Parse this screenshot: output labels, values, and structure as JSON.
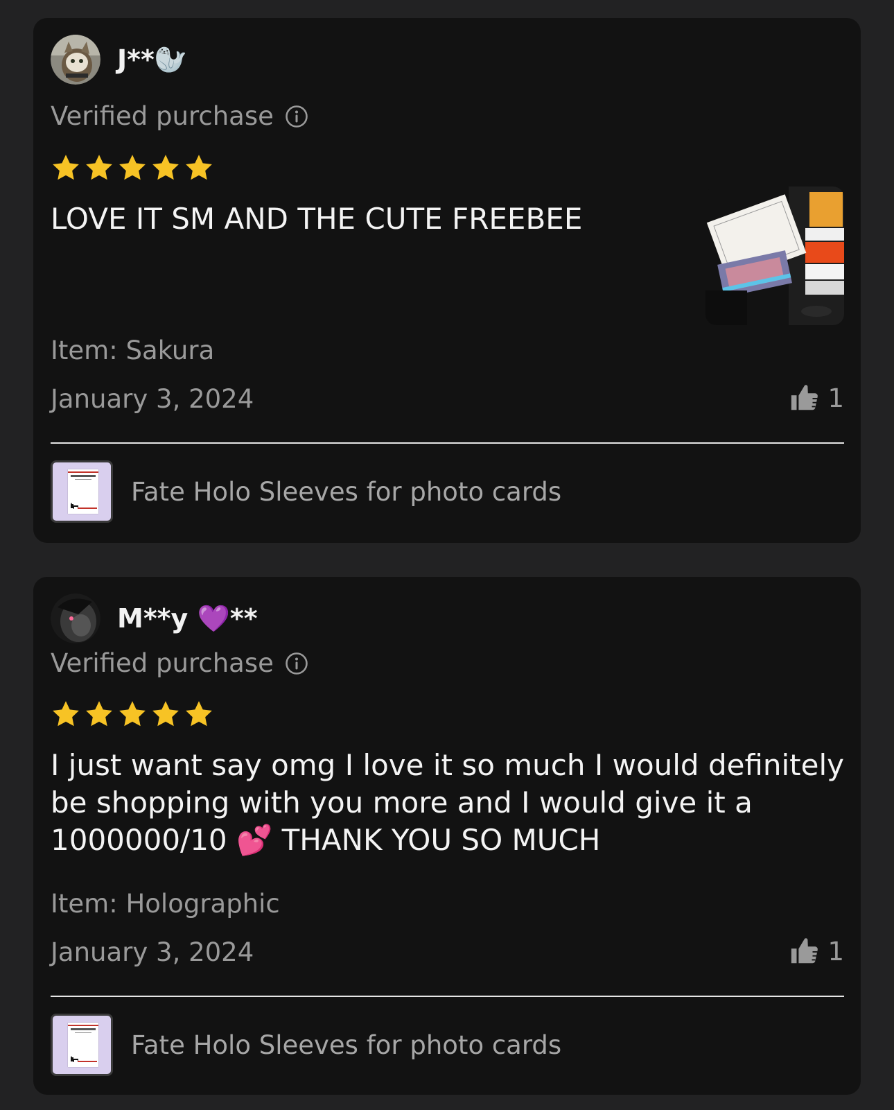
{
  "reviews": [
    {
      "username": "J**🦭",
      "verified_label": "Verified purchase",
      "rating": 5,
      "text": "LOVE IT SM AND THE CUTE FREEBEE",
      "item_label": "Item: Sakura",
      "date": "January 3, 2024",
      "likes": "1",
      "product_name": "Fate Holo Sleeves for photo cards",
      "has_photo": true
    },
    {
      "username": "M**y 💜**",
      "verified_label": "Verified purchase",
      "rating": 5,
      "text": "I just want say omg I love it so much I would definitely be shopping with you more and I would give it a 1000000/10 💕 THANK YOU SO MUCH",
      "item_label": "Item: Holographic",
      "date": "January 3, 2024",
      "likes": "1",
      "product_name": "Fate Holo Sleeves for photo cards",
      "has_photo": false
    }
  ],
  "colors": {
    "page_bg": "#222223",
    "card_bg": "#121212",
    "star": "#f7c325",
    "muted_text": "#9a9a9a",
    "product_thumb_bg": "#d9cfee"
  },
  "icons": [
    "info-icon",
    "star-icon",
    "thumbs-up-icon"
  ]
}
